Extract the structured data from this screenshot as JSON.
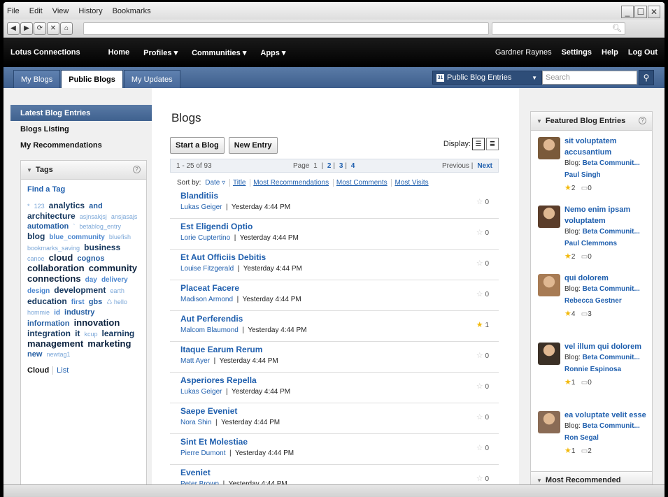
{
  "menu": [
    "File",
    "Edit",
    "View",
    "History",
    "Bookmarks"
  ],
  "topnav": {
    "brand": "Lotus Connections",
    "items": [
      "Home",
      "Profiles ▾",
      "Communities ▾",
      "Apps ▾"
    ],
    "user": "Gardner Raynes",
    "settings": "Settings",
    "help": "Help",
    "logout": "Log Out"
  },
  "tabs": [
    "My Blogs",
    "Public Blogs",
    "My Updates"
  ],
  "scope": {
    "label": "Public Blog Entries",
    "search_placeholder": "Search"
  },
  "leftnav": [
    "Latest Blog Entries",
    "Blogs Listing",
    "My Recommendations"
  ],
  "tags": {
    "title": "Tags",
    "find": "Find a Tag",
    "cloud": [
      [
        "*",
        "t1"
      ],
      [
        "123",
        "t1"
      ],
      [
        "analytics",
        "t4"
      ],
      [
        "and",
        "t3"
      ],
      [
        "architecture",
        "t4"
      ],
      [
        "asjnsakjsj",
        "t1"
      ],
      [
        "ansjasajs",
        "t1"
      ],
      [
        "automation",
        "t3"
      ],
      [
        "`",
        "t1"
      ],
      [
        "betablog_entry",
        "t1"
      ],
      [
        "blog",
        "t4"
      ],
      [
        "blue_community",
        "t2"
      ],
      [
        "bluefish",
        "t1"
      ],
      [
        "bookmarks_saving",
        "t1"
      ],
      [
        "business",
        "t4"
      ],
      [
        "canoe",
        "t1"
      ],
      [
        "cloud",
        "t5"
      ],
      [
        "cognos",
        "t3"
      ],
      [
        "collaboration",
        "t5"
      ],
      [
        "community",
        "t5"
      ],
      [
        "connections",
        "t5"
      ],
      [
        "day",
        "t2"
      ],
      [
        "delivery",
        "t2"
      ],
      [
        "design",
        "t2"
      ],
      [
        "development",
        "t4"
      ],
      [
        "earth",
        "t1"
      ],
      [
        "education",
        "t4"
      ],
      [
        "first",
        "t2"
      ],
      [
        "gbs",
        "t3"
      ],
      [
        "♺ hello",
        "t1"
      ],
      [
        "hommie",
        "t1"
      ],
      [
        "id",
        "t2"
      ],
      [
        "industry",
        "t3"
      ],
      [
        "information",
        "t3"
      ],
      [
        "innovation",
        "t5"
      ],
      [
        "integration",
        "t4"
      ],
      [
        "it",
        "t4"
      ],
      [
        "kcup",
        "t1"
      ],
      [
        "learning",
        "t4"
      ],
      [
        "management",
        "t5"
      ],
      [
        "marketing",
        "t5"
      ],
      [
        "new",
        "t3"
      ],
      [
        "newtag1",
        "t1"
      ]
    ],
    "cloud_label": "Cloud",
    "list_label": "List"
  },
  "main": {
    "title": "Blogs",
    "start_blog": "Start a Blog",
    "new_entry": "New Entry",
    "display": "Display:",
    "range": "1 - 25 of 93",
    "page_label": "Page",
    "pages": [
      "1",
      "2",
      "3",
      "4"
    ],
    "previous": "Previous",
    "next": "Next",
    "sort_label": "Sort by:",
    "sorts": [
      "Date ▿",
      "Title",
      "Most Recommendations",
      "Most Comments",
      "Most Visits"
    ]
  },
  "entries": [
    {
      "title": "Blanditiis",
      "author": "Lukas Geiger",
      "time": "Yesterday 4:44 PM",
      "recs": "0",
      "starred": false
    },
    {
      "title": "Est Eligendi Optio",
      "author": "Lorie Cuptertino",
      "time": "Yesterday 4:44 PM",
      "recs": "0",
      "starred": false
    },
    {
      "title": "Et Aut Officiis Debitis",
      "author": "Louise Fitzgerald",
      "time": "Yesterday 4:44 PM",
      "recs": "0",
      "starred": false
    },
    {
      "title": "Placeat Facere",
      "author": "Madison Armond",
      "time": "Yesterday 4:44 PM",
      "recs": "0",
      "starred": false
    },
    {
      "title": "Aut Perferendis",
      "author": "Malcom Blaumond",
      "time": "Yesterday 4:44 PM",
      "recs": "1",
      "starred": true
    },
    {
      "title": "Itaque Earum Rerum",
      "author": "Matt Ayer",
      "time": "Yesterday 4:44 PM",
      "recs": "0",
      "starred": false
    },
    {
      "title": "Asperiores Repella",
      "author": "Lukas Geiger",
      "time": "Yesterday 4:44 PM",
      "recs": "0",
      "starred": false
    },
    {
      "title": "Saepe Eveniet",
      "author": "Nora Shin",
      "time": "Yesterday 4:44 PM",
      "recs": "0",
      "starred": false
    },
    {
      "title": "Sint Et Molestiae",
      "author": "Pierre Dumont",
      "time": "Yesterday 4:44 PM",
      "recs": "0",
      "starred": false
    },
    {
      "title": "Eveniet",
      "author": "Peter Brown",
      "time": "Yesterday 4:44 PM",
      "recs": "0",
      "starred": false
    }
  ],
  "featured": {
    "title": "Featured Blog Entries",
    "items": [
      {
        "title": "sit voluptatem accusantium",
        "blog": "Beta Communit...",
        "author": "Paul Singh",
        "recs": "2",
        "comments": "0",
        "color": "#7a5a3a"
      },
      {
        "title": "Nemo enim ipsam voluptatem",
        "blog": "Beta Communit...",
        "author": "Paul Clemmons",
        "recs": "2",
        "comments": "0",
        "color": "#5b3d2a"
      },
      {
        "title": "qui dolorem",
        "blog": "Beta Communit...",
        "author": "Rebecca Gestner",
        "recs": "4",
        "comments": "3",
        "color": "#a77b54"
      },
      {
        "title": "vel illum qui dolorem",
        "blog": "Beta Communit...",
        "author": "Ronnie Espinosa",
        "recs": "1",
        "comments": "0",
        "color": "#3b3026"
      },
      {
        "title": "ea voluptate velit esse",
        "blog": "Beta Communit...",
        "author": "Ron Segal",
        "recs": "1",
        "comments": "2",
        "color": "#8a6b55"
      }
    ],
    "blog_label": "Blog:",
    "most_recommended": "Most Recommended"
  }
}
